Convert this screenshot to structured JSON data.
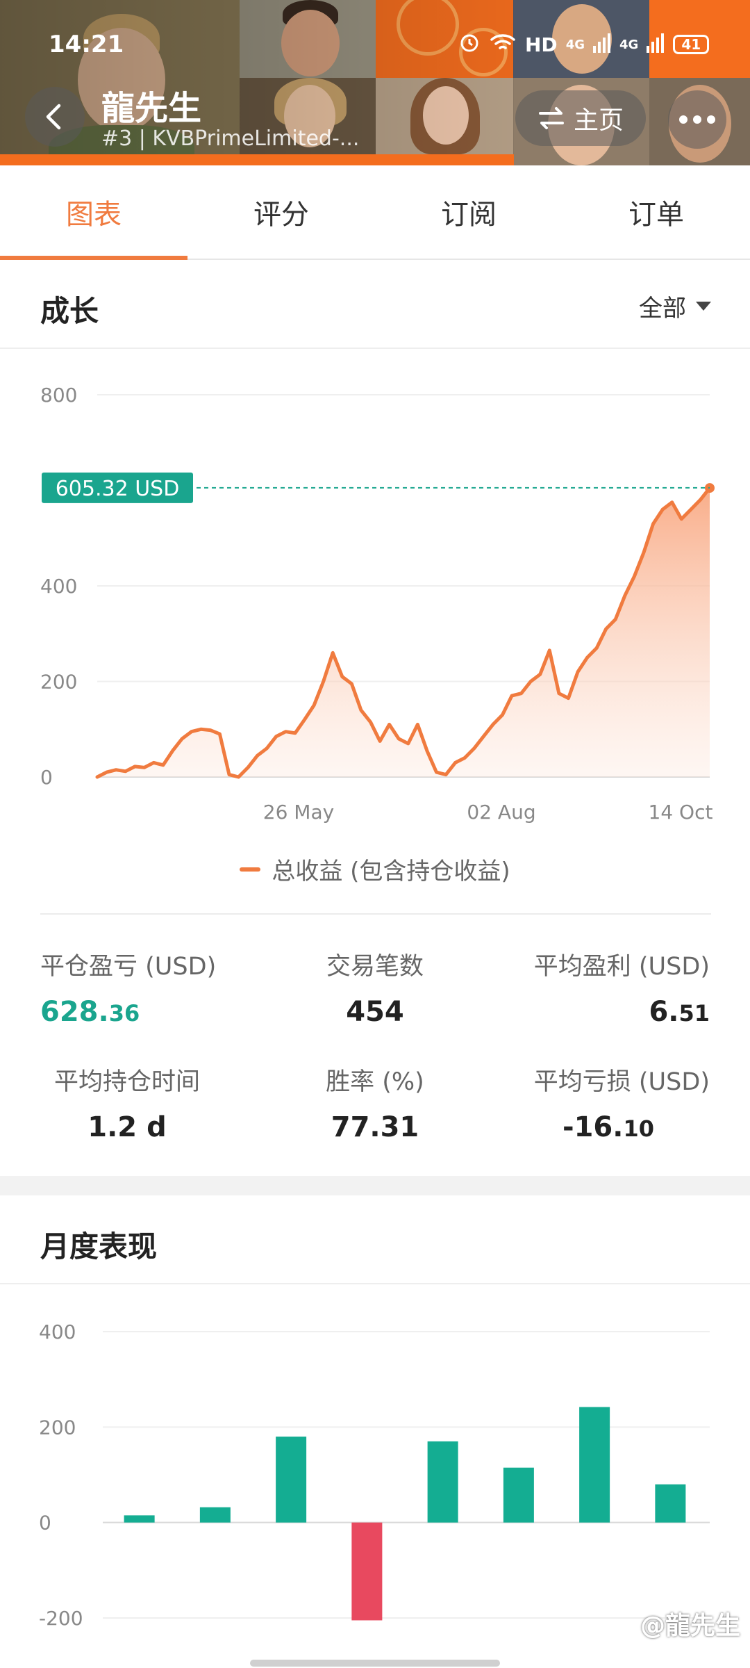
{
  "status_bar": {
    "time": "14:21",
    "network": "HD",
    "signal_1": "4G",
    "signal_2": "4G",
    "battery": "41"
  },
  "header": {
    "trader_name": "龍先生",
    "trader_sub": "#3 | KVBPrimeLimited-...",
    "home_label": "主页"
  },
  "tabs": [
    {
      "label": "图表",
      "active": true
    },
    {
      "label": "评分",
      "active": false
    },
    {
      "label": "订阅",
      "active": false
    },
    {
      "label": "订单",
      "active": false
    }
  ],
  "growth": {
    "title": "成长",
    "range": "全部",
    "legend": "总收益 (包含持仓收益)",
    "current_label": "605.32 USD",
    "colors": {
      "line": "#f07b3f",
      "marker": "#1aa58e"
    }
  },
  "stats": {
    "closed_pnl": {
      "label": "平仓盈亏 (USD)",
      "int": "628.",
      "dec": "36"
    },
    "trades": {
      "label": "交易笔数",
      "value": "454"
    },
    "avg_profit": {
      "label": "平均盈利 (USD)",
      "int": "6.",
      "dec": "51"
    },
    "avg_hold": {
      "label": "平均持仓时间",
      "value": "1.2 d"
    },
    "win_rate": {
      "label": "胜率 (%)",
      "value": "77.31"
    },
    "avg_loss": {
      "label": "平均亏损 (USD)",
      "int": "-16.",
      "dec": "10"
    }
  },
  "monthly": {
    "title": "月度表现",
    "colors": {
      "positive": "#14ad92",
      "negative": "#e8495f"
    }
  },
  "watermark": "@龍先生",
  "chart_data": [
    {
      "type": "area",
      "title": "",
      "xlabel": "",
      "ylabel": "",
      "ylim": [
        0,
        800
      ],
      "yticks": [
        0,
        200,
        400,
        800
      ],
      "xticks": [
        "26 May",
        "02 Aug",
        "14 Oct"
      ],
      "grid": true,
      "series": [
        {
          "name": "总收益 (包含持仓收益)",
          "values": [
            0,
            10,
            15,
            12,
            22,
            20,
            30,
            25,
            55,
            80,
            95,
            100,
            98,
            90,
            5,
            0,
            20,
            45,
            60,
            85,
            95,
            92,
            120,
            150,
            200,
            260,
            210,
            195,
            140,
            115,
            75,
            110,
            80,
            70,
            110,
            55,
            10,
            5,
            30,
            40,
            60,
            85,
            110,
            130,
            170,
            175,
            200,
            215,
            265,
            175,
            165,
            220,
            250,
            270,
            310,
            330,
            380,
            420,
            470,
            530,
            560,
            575,
            540,
            560,
            580,
            605
          ]
        }
      ],
      "markers": [
        {
          "label": "605.32 USD",
          "y": 605.32
        }
      ]
    },
    {
      "type": "bar",
      "title": "",
      "ylim": [
        -200,
        400
      ],
      "yticks": [
        -200,
        0,
        200,
        400
      ],
      "grid": true,
      "series": [
        {
          "values": [
            15,
            32,
            180,
            -205,
            170,
            115,
            242,
            80
          ]
        }
      ]
    }
  ]
}
